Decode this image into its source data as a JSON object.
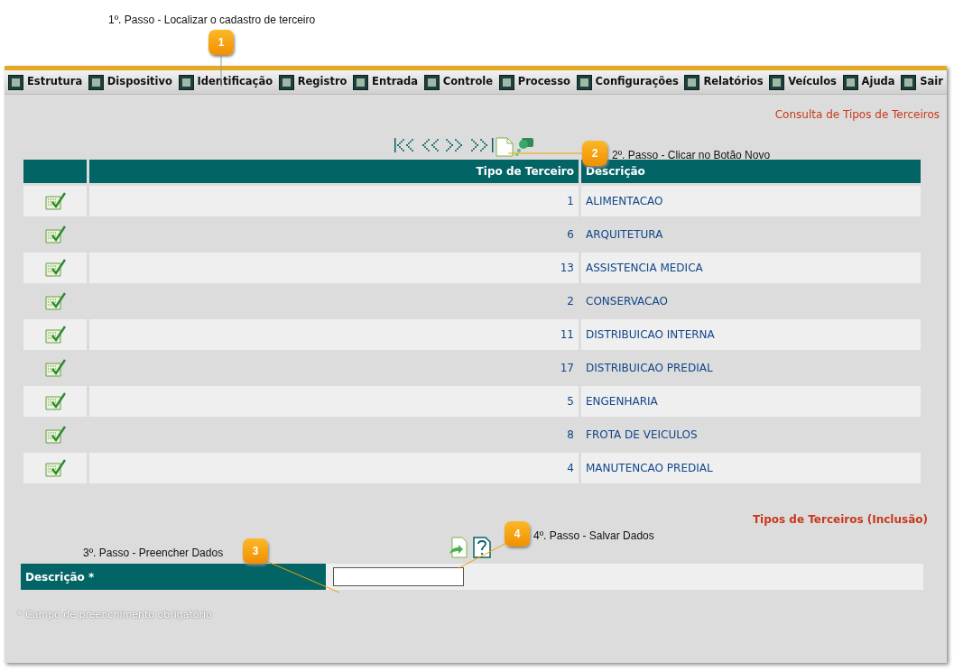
{
  "annotations": [
    {
      "number": "1",
      "text": "1º. Passo - Localizar o cadastro de terceiro"
    },
    {
      "number": "2",
      "text": "2º. Passo - Clicar no Botão Novo"
    },
    {
      "number": "3",
      "text": "3º. Passo - Preencher Dados"
    },
    {
      "number": "4",
      "text": "4º. Passo - Salvar Dados"
    }
  ],
  "menu": [
    "Estrutura",
    "Dispositivo",
    "Identificação",
    "Registro",
    "Entrada",
    "Controle",
    "Processo",
    "Configurações",
    "Relatórios",
    "Veículos",
    "Ajuda",
    "Sair"
  ],
  "page_title": "Consulta de Tipos de Terceiros",
  "table": {
    "columns": [
      "Tipo de Terceiro",
      "Descrição"
    ],
    "rows": [
      {
        "code": "1",
        "description": "ALIMENTACAO"
      },
      {
        "code": "6",
        "description": "ARQUITETURA"
      },
      {
        "code": "13",
        "description": "ASSISTENCIA MEDICA"
      },
      {
        "code": "2",
        "description": "CONSERVACAO"
      },
      {
        "code": "11",
        "description": "DISTRIBUICAO INTERNA"
      },
      {
        "code": "17",
        "description": "DISTRIBUICAO PREDIAL"
      },
      {
        "code": "5",
        "description": "ENGENHARIA"
      },
      {
        "code": "8",
        "description": "FROTA DE VEICULOS"
      },
      {
        "code": "4",
        "description": "MANUTENCAO PREDIAL"
      }
    ]
  },
  "form": {
    "title": "Tipos de Terceiros (Inclusão)",
    "fields": [
      {
        "label": "Descrição *"
      }
    ]
  },
  "footnote": "* Campo de preenchimento obrigatório"
}
